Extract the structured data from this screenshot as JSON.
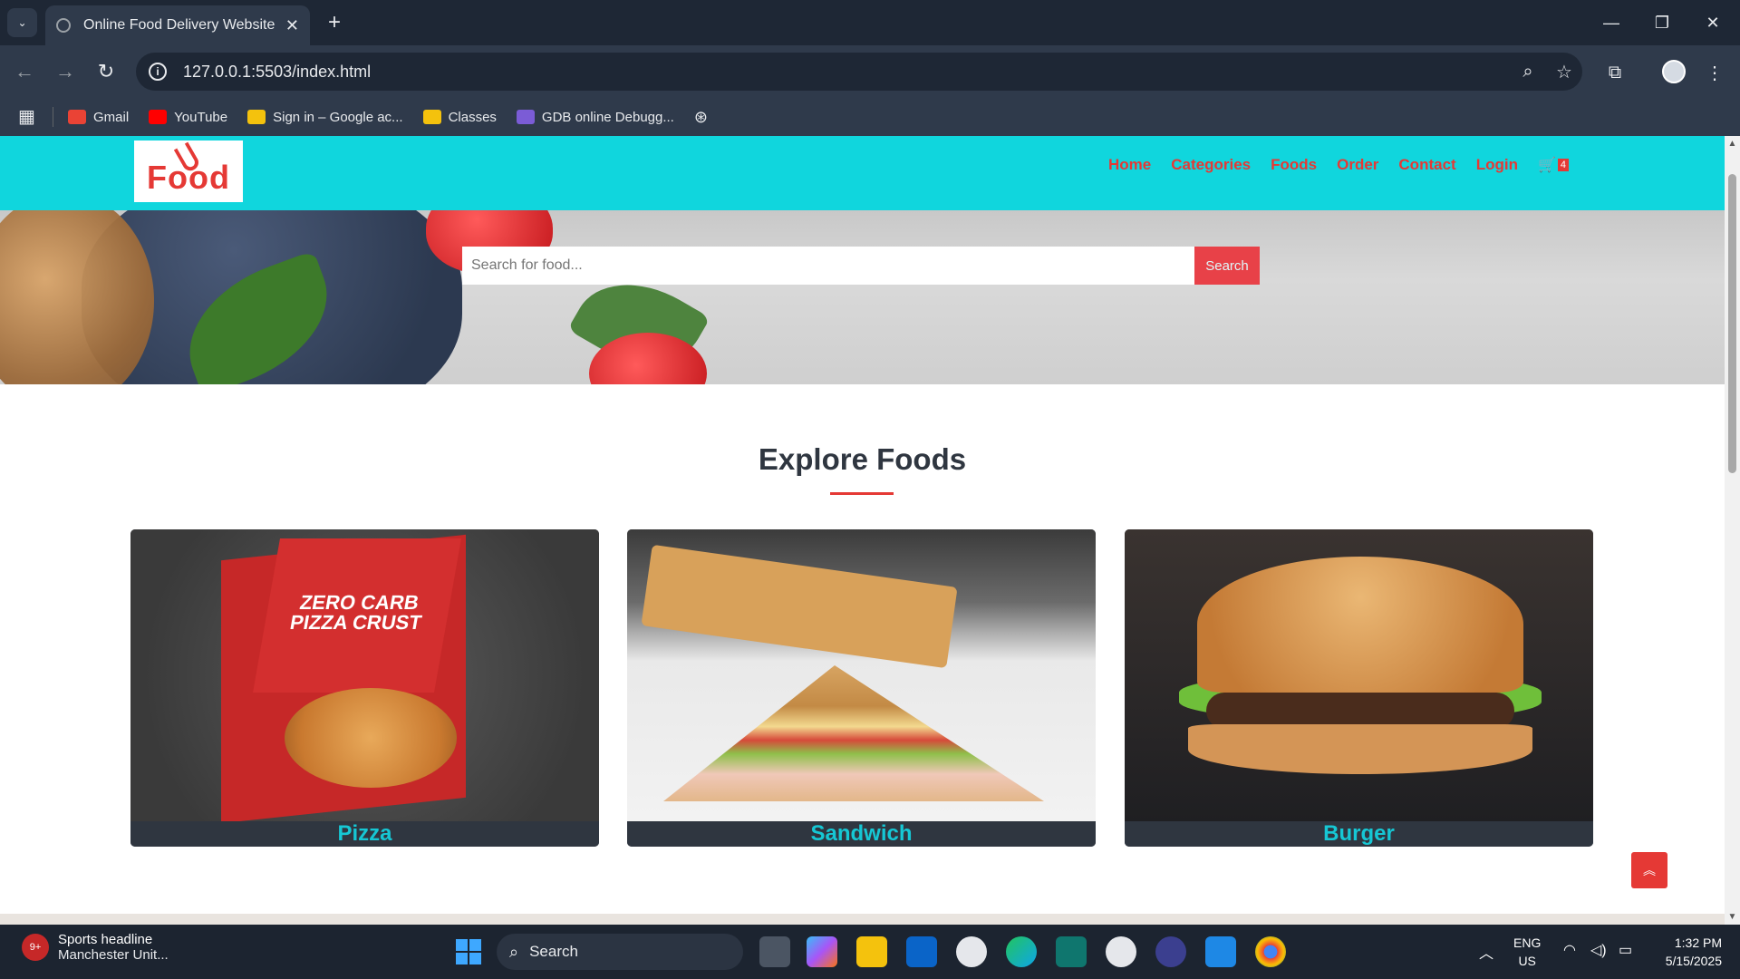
{
  "browser": {
    "tab_title": "Online Food Delivery Website",
    "url": "127.0.0.1:5503/index.html",
    "bookmarks": [
      {
        "label": "Gmail",
        "color": "#ea4335"
      },
      {
        "label": "YouTube",
        "color": "#ff0000"
      },
      {
        "label": "Sign in – Google ac...",
        "color": "#f4c20d"
      },
      {
        "label": "Classes",
        "color": "#f4c20d"
      },
      {
        "label": "GDB online Debugg...",
        "color": "#7b5cd6"
      }
    ]
  },
  "site": {
    "logo_text": "Food",
    "nav": [
      "Home",
      "Categories",
      "Foods",
      "Order",
      "Contact",
      "Login"
    ],
    "cart_count": "4",
    "search": {
      "placeholder": "Search for food...",
      "button": "Search"
    },
    "section_title": "Explore Foods",
    "categories": [
      "Pizza",
      "Sandwich",
      "Burger"
    ],
    "pizza_box_text": "ZERO CARB PIZZA CRUST",
    "colors": {
      "header": "#10d6dd",
      "accent": "#e53935",
      "label": "#16c7d4",
      "card": "#2f3640"
    }
  },
  "taskbar": {
    "news_title": "Sports headline",
    "news_sub": "Manchester Unit...",
    "news_badge": "9+",
    "search_label": "Search",
    "lang_top": "ENG",
    "lang_bottom": "US",
    "time": "1:32 PM",
    "date": "5/15/2025"
  }
}
